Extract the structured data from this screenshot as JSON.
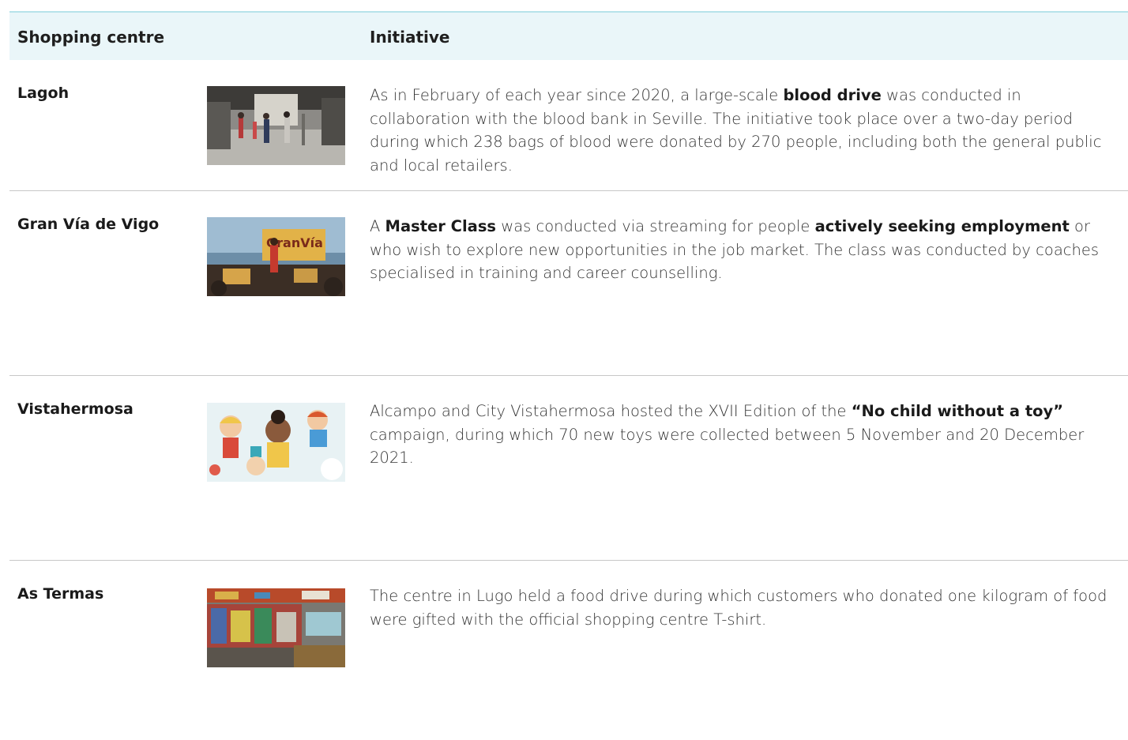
{
  "header": {
    "col_centre": "Shopping centre",
    "col_initiative": "Initiative"
  },
  "rows": [
    {
      "centre": "Lagoh",
      "image": "blood-drive-photo",
      "text": [
        {
          "t": "As in February of each year since 2020, a large-scale ",
          "b": false
        },
        {
          "t": "blood drive",
          "b": true
        },
        {
          "t": " was conducted in collaboration with the blood bank in Seville. The initiative took place over a two-day period during which 238 bags of blood were donated by 270 people, including both the general public and local retailers.",
          "b": false
        }
      ]
    },
    {
      "centre": "Gran Vía de Vigo",
      "image": "master-class-photo",
      "image_text": "GranVía",
      "text": [
        {
          "t": "A ",
          "b": false
        },
        {
          "t": "Master Class",
          "b": true
        },
        {
          "t": " was conducted via streaming for people ",
          "b": false
        },
        {
          "t": "actively seeking employment",
          "b": true
        },
        {
          "t": " or who wish to explore new opportunities in the job market. The class was conducted by coaches specialised in training and career counselling.",
          "b": false
        }
      ]
    },
    {
      "centre": "Vistahermosa",
      "image": "toy-campaign-illustration",
      "text": [
        {
          "t": "Alcampo and City Vistahermosa hosted the XVII Edition of the ",
          "b": false
        },
        {
          "t": "“No child without a toy”",
          "b": true
        },
        {
          "t": " campaign, during which 70 new toys were collected between 5 November and 20 December 2021.",
          "b": false
        }
      ]
    },
    {
      "centre": "As Termas",
      "image": "food-drive-photo",
      "text": [
        {
          "t": "The centre in Lugo held a food drive during which customers who donated one kilogram of food were gifted with the official shopping centre T-shirt.",
          "b": false
        }
      ]
    }
  ]
}
